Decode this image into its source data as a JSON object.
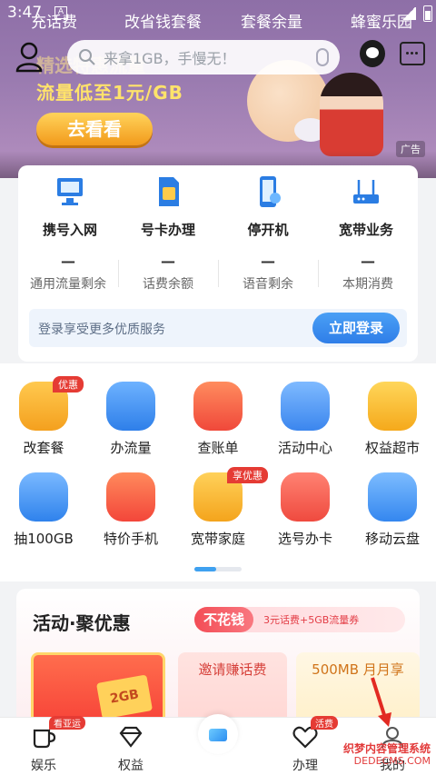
{
  "status_bar": {
    "time": "3:47",
    "a_icon": "A"
  },
  "top_nav": {
    "items": [
      "充话费",
      "改省钱套餐",
      "套餐余量",
      "蜂蜜乐园"
    ]
  },
  "search": {
    "placeholder": "来拿1GB，手慢无！"
  },
  "banner": {
    "faded_title": "精选特惠流量",
    "slogan": "流量低至1元/GB",
    "button": "去看看",
    "ad_label": "广告"
  },
  "services": [
    {
      "label": "携号入网",
      "icon": "computer-icon"
    },
    {
      "label": "号卡办理",
      "icon": "sim-card-icon"
    },
    {
      "label": "停开机",
      "icon": "phone-icon"
    },
    {
      "label": "宽带业务",
      "icon": "router-icon"
    }
  ],
  "stats": [
    {
      "value": "—",
      "label": "通用流量剩余"
    },
    {
      "value": "—",
      "label": "话费余额"
    },
    {
      "value": "—",
      "label": "语音剩余"
    },
    {
      "value": "—",
      "label": "本期消费"
    }
  ],
  "login_bar": {
    "text": "登录享受更多优质服务",
    "button": "立即登录"
  },
  "grid": [
    {
      "label": "改套餐",
      "tag": "优惠",
      "color": "#f7a928"
    },
    {
      "label": "办流量",
      "tag": "",
      "color": "#3d8ef2"
    },
    {
      "label": "查账单",
      "tag": "",
      "color": "#f2613b"
    },
    {
      "label": "活动中心",
      "tag": "",
      "color": "#4f9df2"
    },
    {
      "label": "权益超市",
      "tag": "",
      "color": "#f5b21e"
    },
    {
      "label": "抽100GB",
      "tag": "",
      "color": "#3d8ef2"
    },
    {
      "label": "特价手机",
      "tag": "",
      "color": "#f35b3b"
    },
    {
      "label": "宽带家庭",
      "tag": "享优惠",
      "color": "#f6b324"
    },
    {
      "label": "选号办卡",
      "tag": "",
      "color": "#f25a4b"
    },
    {
      "label": "移动云盘",
      "tag": "",
      "color": "#3f95f1"
    }
  ],
  "activity": {
    "title": "活动·聚优惠",
    "pill_main": "不花钱",
    "pill_sub": "3元话费+5GB流量券",
    "tiles": [
      "2GB",
      "邀请赚话费",
      "500MB 月月享"
    ]
  },
  "tabbar": [
    {
      "label": "娱乐",
      "badge": "看亚运"
    },
    {
      "label": "权益",
      "badge": ""
    },
    {
      "label": "",
      "badge": ""
    },
    {
      "label": "办理",
      "badge": "活费"
    },
    {
      "label": "我的",
      "badge": ""
    }
  ],
  "watermark": {
    "line1": "织梦内容管理系统",
    "line2": "DEDECMS.COM"
  }
}
